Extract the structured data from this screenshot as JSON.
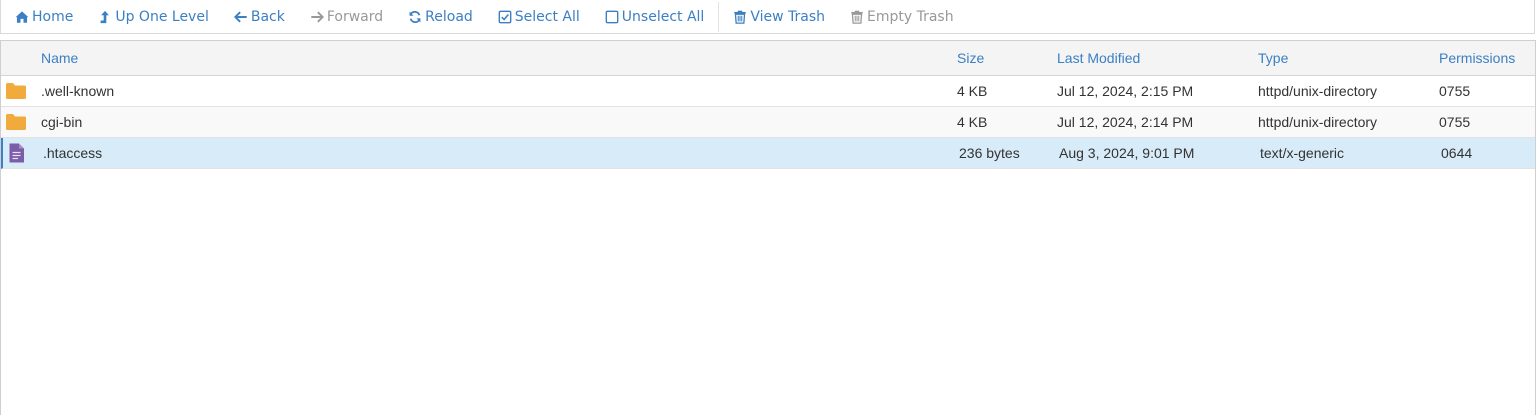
{
  "toolbar": {
    "home": "Home",
    "up": "Up One Level",
    "back": "Back",
    "forward": "Forward",
    "reload": "Reload",
    "select_all": "Select All",
    "unselect_all": "Unselect All",
    "view_trash": "View Trash",
    "empty_trash": "Empty Trash"
  },
  "columns": {
    "name": "Name",
    "size": "Size",
    "modified": "Last Modified",
    "type": "Type",
    "permissions": "Permissions"
  },
  "files": [
    {
      "name": ".well-known",
      "size": "4 KB",
      "modified": "Jul 12, 2024, 2:15 PM",
      "type": "httpd/unix-directory",
      "permissions": "0755",
      "icon": "folder-icon"
    },
    {
      "name": "cgi-bin",
      "size": "4 KB",
      "modified": "Jul 12, 2024, 2:14 PM",
      "type": "httpd/unix-directory",
      "permissions": "0755",
      "icon": "folder-icon"
    },
    {
      "name": ".htaccess",
      "size": "236 bytes",
      "modified": "Aug 3, 2024, 9:01 PM",
      "type": "text/x-generic",
      "permissions": "0644",
      "icon": "file-text-icon",
      "selected": true
    }
  ],
  "colors": {
    "accent": "#3b7fc4",
    "disabled": "#999999",
    "folder": "#f0ab3c",
    "file": "#7b5ea7",
    "selected_row": "#d8ebf8"
  }
}
